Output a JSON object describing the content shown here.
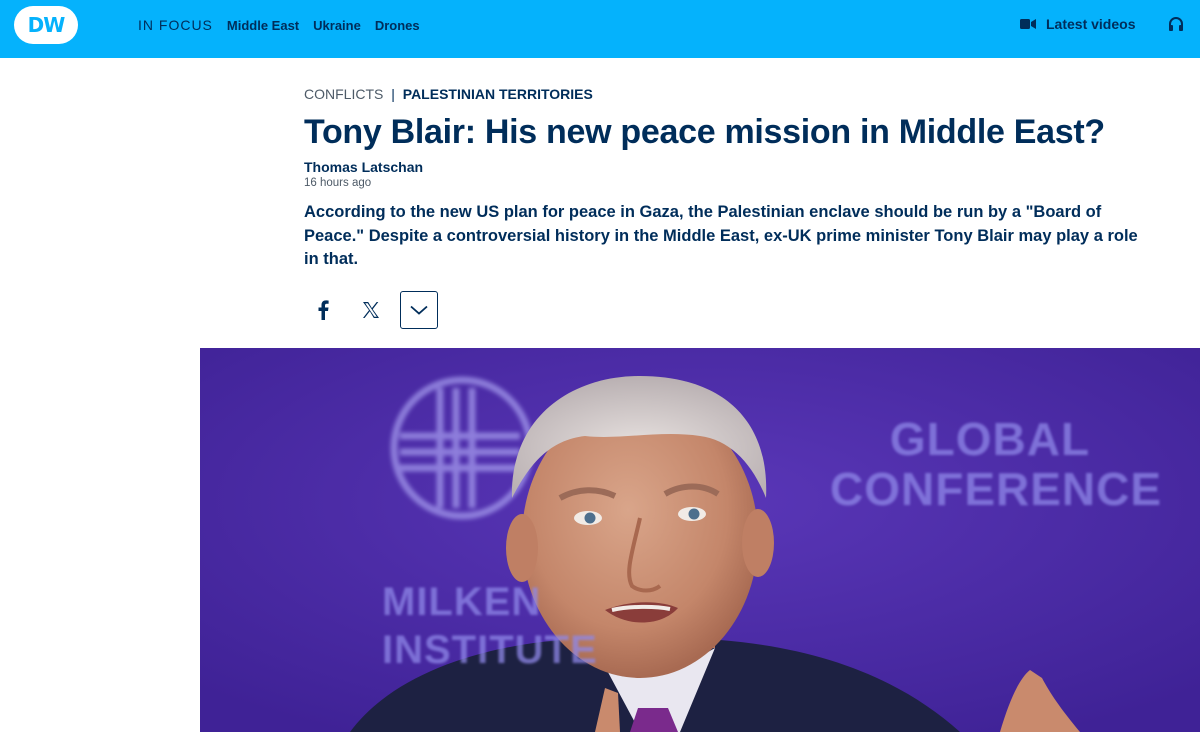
{
  "header": {
    "logo_text": "DW",
    "in_focus_label": "IN FOCUS",
    "nav_links": [
      "Middle East",
      "Ukraine",
      "Drones"
    ],
    "latest_videos_label": "Latest videos",
    "icons": [
      "video-camera-icon",
      "headphones-icon"
    ],
    "brand_color": "#05b2fc",
    "text_color": "#002d5a"
  },
  "article": {
    "category": "CONFLICTS",
    "separator": "|",
    "subcategory": "PALESTINIAN TERRITORIES",
    "headline": "Tony Blair: His new peace mission in Middle East?",
    "author": "Thomas Latschan",
    "published": "16 hours ago",
    "teaser": "According to the new US plan for peace in Gaza, the Palestinian enclave should be run by a \"Board of Peace.\" Despite a controversial history in the Middle East, ex-UK prime minister Tony Blair may play a role in that.",
    "share_icons": [
      "facebook-icon",
      "x-icon",
      "chevron-down-icon"
    ]
  },
  "hero_image": {
    "backdrop_text_1": "GLOBAL",
    "backdrop_text_2": "CONFERENCE",
    "backdrop_text_3": "MILKEN",
    "backdrop_text_4": "INSTITUTE",
    "background_color": "#4a2aa3"
  }
}
